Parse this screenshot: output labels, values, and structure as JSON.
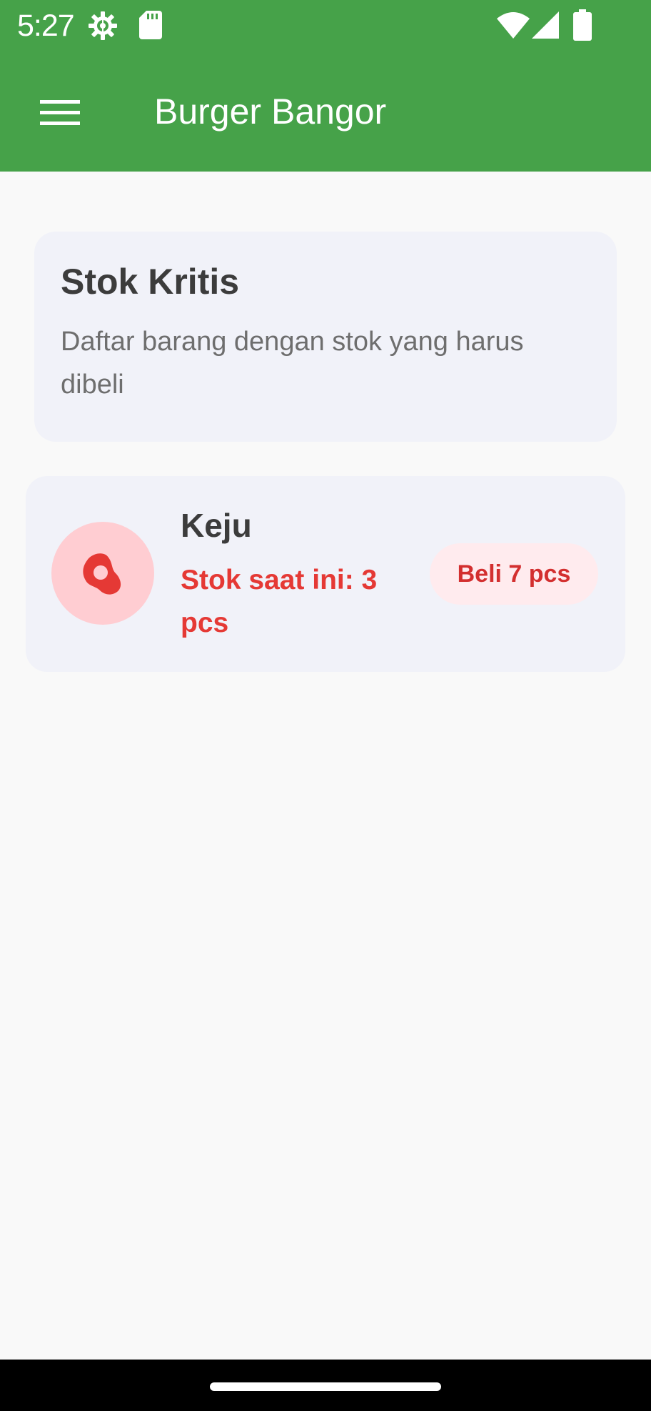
{
  "status_bar": {
    "time": "5:27",
    "icons": [
      "gear-icon",
      "sd-card-icon",
      "wifi-icon",
      "cell-signal-icon",
      "battery-icon"
    ]
  },
  "app_bar": {
    "title": "Burger Bangor",
    "menu_icon": "hamburger-menu-icon",
    "background_color": "#46a249"
  },
  "header_card": {
    "title": "Stok Kritis",
    "subtitle": "Daftar barang dengan stok yang harus dibeli"
  },
  "items": [
    {
      "name": "Keju",
      "stock_text": "Stok saat ini: 3 pcs",
      "buy_label": "Beli 7 pcs",
      "icon": "egg-icon",
      "accent_color": "#e53935"
    }
  ]
}
